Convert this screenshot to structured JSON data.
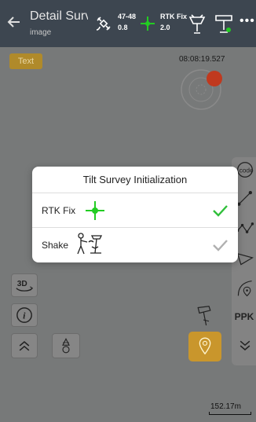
{
  "toolbar": {
    "title": "Detail Surve",
    "subtitle": "image",
    "satellites": "47-48",
    "pdop": "0.8",
    "solution": "RTK Fix",
    "age": "2.0",
    "more": "•••"
  },
  "map": {
    "text_button": "Text",
    "timestamp": "08:08:19.527",
    "scale": "152.17m"
  },
  "left_tools": {
    "three_d": "3D"
  },
  "right_tools": {
    "ppk": "PPK"
  },
  "dialog": {
    "title": "Tilt Survey Initialization",
    "rows": [
      {
        "label": "RTK Fix",
        "icon": "rtk-fix-crosshair-icon",
        "status": "checked",
        "check_color": "#2fbf3a"
      },
      {
        "label": "Shake",
        "icon": "shake-pole-icon",
        "status": "pending",
        "check_color": "#b0b0b0"
      }
    ]
  },
  "colors": {
    "toolbar": "#3d4650",
    "accent": "#c9962c",
    "fix_green": "#22cc22"
  }
}
